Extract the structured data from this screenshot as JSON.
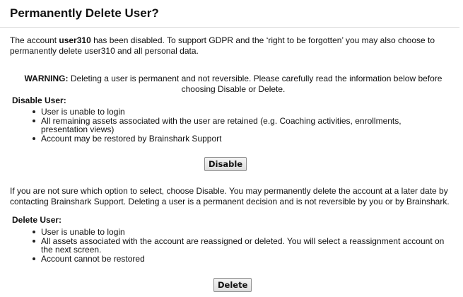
{
  "dialog": {
    "title": "Permanently Delete User?",
    "intro": {
      "part1": "The account ",
      "username": "user310",
      "part2": " has been disabled. To support GDPR and the ‘right to be forgotten’ you may also choose to permanently delete user310 and all personal data."
    },
    "warning": {
      "label": "WARNING:",
      "text": " Deleting a user is permanent and not reversible. Please carefully read the information below before choosing Disable or Delete."
    },
    "disable_section": {
      "heading": "Disable User:",
      "items": [
        "User is unable to login",
        "All remaining assets associated with the user are retained (e.g. Coaching activities, enrollments, presentation views)",
        "Account may be restored by Brainshark Support"
      ],
      "button_label": "Disable"
    },
    "note": "If you are not sure which option to select, choose Disable. You may permanently delete the account at a later date by contacting Brainshark Support. Deleting a user is a permanent decision and is not reversible by you or by Brainshark.",
    "delete_section": {
      "heading": "Delete User:",
      "items": [
        "User is unable to login",
        "All assets associated with the account are reassigned or deleted. You will select a reassignment account on the next screen.",
        "Account cannot be restored"
      ],
      "button_label": "Delete"
    }
  }
}
